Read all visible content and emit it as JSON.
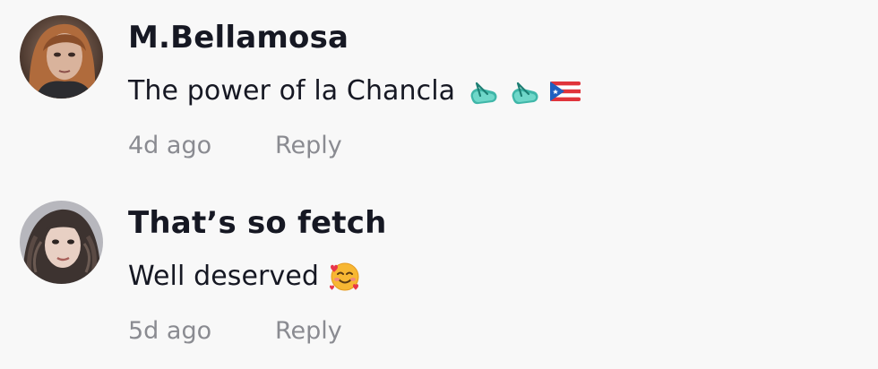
{
  "comments": [
    {
      "username": "M.Bellamosa",
      "text": "The power of la Chancla",
      "emojis": [
        "flip-flop-emoji",
        "flip-flop-emoji",
        "puerto-rico-flag-emoji"
      ],
      "time": "4d ago",
      "reply_label": "Reply"
    },
    {
      "username": "That’s so fetch",
      "text": "Well deserved",
      "emojis": [
        "smiling-face-with-hearts-emoji"
      ],
      "time": "5d ago",
      "reply_label": "Reply"
    }
  ],
  "colors": {
    "background": "#f8f8f8",
    "text": "#161823",
    "meta": "#8a8b91"
  }
}
